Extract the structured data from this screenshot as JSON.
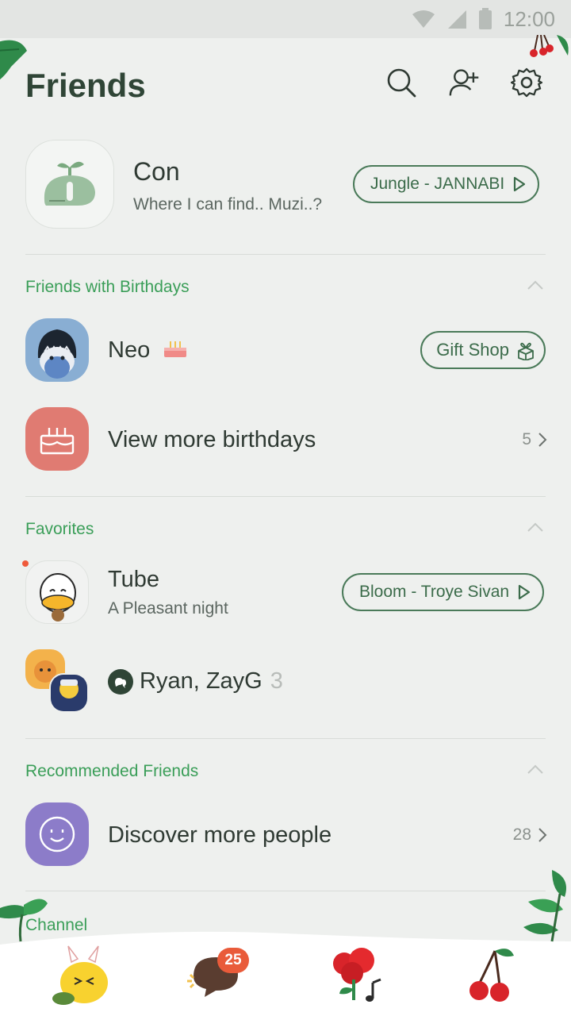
{
  "status_bar": {
    "time": "12:00"
  },
  "header": {
    "title": "Friends"
  },
  "profile": {
    "name": "Con",
    "status_message": "Where I can find.. Muzi..?",
    "music": "Jungle - JANNABI"
  },
  "birthdays": {
    "title": "Friends with Birthdays",
    "friend_name": "Neo",
    "gift_label": "Gift Shop",
    "more_label": "View more birthdays",
    "more_count": "5"
  },
  "favorites": {
    "title": "Favorites",
    "friend_name": "Tube",
    "friend_status": "A Pleasant night",
    "friend_music": "Bloom - Troye Sivan",
    "group_name": "Ryan, ZayG",
    "group_count": "3"
  },
  "recommended": {
    "title": "Recommended Friends",
    "discover_label": "Discover more people",
    "discover_count": "28"
  },
  "channel": {
    "title": "Channel"
  },
  "bottom_nav": {
    "chats_badge": "25",
    "items": [
      "friends-tab-icon",
      "chats-tab-icon",
      "view-tab-icon",
      "more-tab-icon"
    ]
  },
  "colors": {
    "accent_green": "#3a9e58",
    "pill_border": "#4a7a59",
    "badge_red": "#e95b3a",
    "background": "#eef0ee"
  }
}
